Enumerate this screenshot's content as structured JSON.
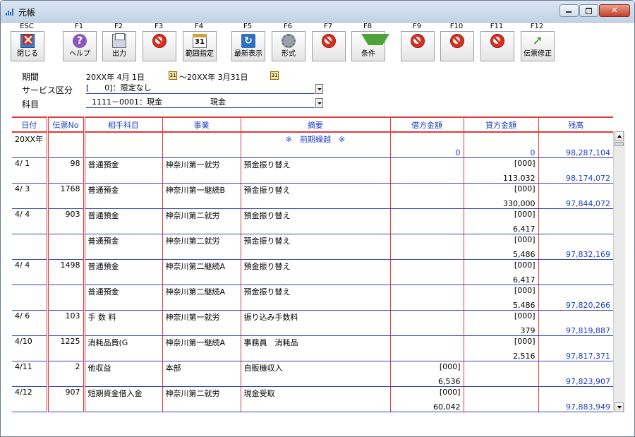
{
  "window": {
    "title": "元帳"
  },
  "toolbar": [
    {
      "fkey": "ESC",
      "label": "閉じる",
      "icon": "exit-icon"
    },
    {
      "fkey": "F1",
      "label": "ヘルプ",
      "icon": "help-icon"
    },
    {
      "fkey": "F2",
      "label": "出力",
      "icon": "print-icon"
    },
    {
      "fkey": "F3",
      "label": "",
      "icon": "disabled-icon"
    },
    {
      "fkey": "F4",
      "label": "範囲指定",
      "icon": "calendar-icon"
    },
    {
      "fkey": "F5",
      "label": "最新表示",
      "icon": "refresh-icon"
    },
    {
      "fkey": "F6",
      "label": "形式",
      "icon": "gear-icon"
    },
    {
      "fkey": "F7",
      "label": "",
      "icon": "disabled-icon"
    },
    {
      "fkey": "F8",
      "label": "条件",
      "icon": "filter-icon"
    },
    {
      "fkey": "F9",
      "label": "",
      "icon": "disabled-icon"
    },
    {
      "fkey": "F10",
      "label": "",
      "icon": "disabled-icon"
    },
    {
      "fkey": "F11",
      "label": "",
      "icon": "disabled-icon"
    },
    {
      "fkey": "F12",
      "label": "伝票修正",
      "icon": "arrow-icon"
    }
  ],
  "header": {
    "period_label": "期間",
    "period_from": "20XX年 4月 1日",
    "period_to": "～20XX年 3月31日",
    "service_label": "サービス区分",
    "service_value": "[　　0]：限定なし",
    "account_label": "科目",
    "account_value": "1111－0001：現金",
    "account_name": "現金"
  },
  "table": {
    "columns": [
      "日付",
      "伝票No",
      "相手科目",
      "事業",
      "摘要",
      "借方金額",
      "貸方金額",
      "残高"
    ],
    "carryover": {
      "date": "20XX年",
      "desc": "※　前期繰越　※",
      "debit": "0",
      "credit": "0",
      "balance": "98,287,104"
    },
    "rows": [
      {
        "date": "4/ 1",
        "no": "98",
        "acct": "普通預金",
        "biz": "神奈川第一就労",
        "desc": "預金振り替え",
        "debit_code": "",
        "debit": "",
        "credit_code": "[000]",
        "credit": "113,032",
        "balance": "98,174,072"
      },
      {
        "date": "4/ 3",
        "no": "1768",
        "acct": "普通預金",
        "biz": "神奈川第一継続B",
        "desc": "預金振り替え",
        "debit_code": "",
        "debit": "",
        "credit_code": "[000]",
        "credit": "330,000",
        "balance": "97,844,072"
      },
      {
        "date": "4/ 4",
        "no": "903",
        "acct": "普通預金",
        "biz": "神奈川第二就労",
        "desc": "預金振り替え",
        "debit_code": "",
        "debit": "",
        "credit_code": "[000]",
        "credit": "6,417",
        "balance": ""
      },
      {
        "date": "",
        "no": "",
        "acct": "普通預金",
        "biz": "神奈川第二就労",
        "desc": "預金振り替え",
        "debit_code": "",
        "debit": "",
        "credit_code": "[000]",
        "credit": "5,486",
        "balance": "97,832,169"
      },
      {
        "date": "4/ 4",
        "no": "1498",
        "acct": "普通預金",
        "biz": "神奈川第二継続A",
        "desc": "預金振り替え",
        "debit_code": "",
        "debit": "",
        "credit_code": "[000]",
        "credit": "6,417",
        "balance": ""
      },
      {
        "date": "",
        "no": "",
        "acct": "普通預金",
        "biz": "神奈川第二継続A",
        "desc": "預金振り替え",
        "debit_code": "",
        "debit": "",
        "credit_code": "[000]",
        "credit": "5,486",
        "balance": "97,820,266"
      },
      {
        "date": "4/ 6",
        "no": "103",
        "acct": "手 数 料",
        "biz": "神奈川第一就労",
        "desc": "振り込み手数料",
        "debit_code": "",
        "debit": "",
        "credit_code": "[000]",
        "credit": "379",
        "balance": "97,819,887"
      },
      {
        "date": "4/10",
        "no": "1225",
        "acct": "消耗品費(G",
        "biz": "神奈川第一継続A",
        "desc": "事務員　消耗品",
        "debit_code": "",
        "debit": "",
        "credit_code": "[000]",
        "credit": "2,516",
        "balance": "97,817,371"
      },
      {
        "date": "4/11",
        "no": "2",
        "acct": "他収益",
        "biz": "本部",
        "desc": "自販機収入",
        "debit_code": "[000]",
        "debit": "6,536",
        "credit_code": "",
        "credit": "",
        "balance": "97,823,907"
      },
      {
        "date": "4/12",
        "no": "907",
        "acct": "短期資金借入金",
        "biz": "神奈川第二就労",
        "desc": "現金受取",
        "debit_code": "[000]",
        "debit": "60,042",
        "credit_code": "",
        "credit": "",
        "balance": "97,883,949"
      }
    ]
  }
}
